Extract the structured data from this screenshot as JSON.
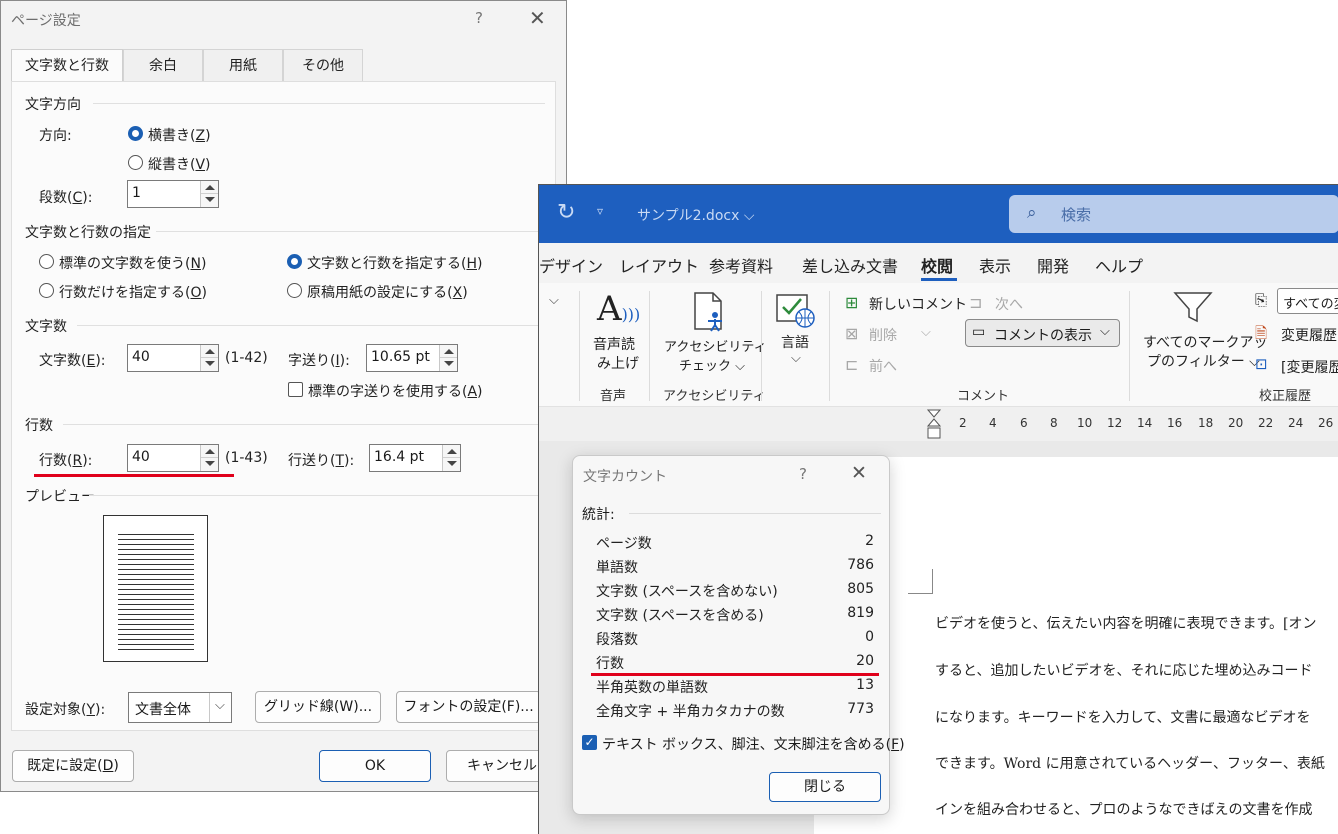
{
  "page_setup": {
    "title": "ページ設定",
    "help": "?",
    "close": "✕",
    "tabs": [
      "文字数と行数",
      "余白",
      "用紙",
      "その他"
    ],
    "direction": {
      "section": "文字方向",
      "label_pre": "方向:",
      "horizontal": {
        "text": "横書き(",
        "key": "Z",
        "end": ")"
      },
      "vertical": {
        "text": "縦書き(",
        "key": "V",
        "end": ")"
      },
      "columns_pre": "段数(",
      "columns_key": "C",
      "columns_end": "):",
      "columns_value": "1"
    },
    "grid": {
      "section": "文字数と行数の指定",
      "opt1": {
        "text": "標準の文字数を使う(",
        "key": "N",
        "end": ")"
      },
      "opt2": {
        "text": "文字数と行数を指定する(",
        "key": "H",
        "end": ")"
      },
      "opt3": {
        "text": "行数だけを指定する(",
        "key": "O",
        "end": ")"
      },
      "opt4": {
        "text": "原稿用紙の設定にする(",
        "key": "X",
        "end": ")"
      }
    },
    "chars": {
      "section": "文字数",
      "label_pre": "文字数(",
      "label_key": "E",
      "label_end": "):",
      "value": "40",
      "range": "(1-42)",
      "pitch_pre": "字送り(",
      "pitch_key": "I",
      "pitch_end": "):",
      "pitch_value": "10.65 pt",
      "std_pitch": {
        "text": "標準の字送りを使用する(",
        "key": "A",
        "end": ")"
      }
    },
    "lines": {
      "section": "行数",
      "label_pre": "行数(",
      "label_key": "R",
      "label_end": "):",
      "value": "40",
      "range": "(1-43)",
      "pitch_pre": "行送り(",
      "pitch_key": "T",
      "pitch_end": "):",
      "pitch_value": "16.4 pt"
    },
    "preview": "プレビュー",
    "apply_pre": "設定対象(",
    "apply_key": "Y",
    "apply_end": "):",
    "apply_value": "文書全体",
    "grid_button": "グリッド線(W)...",
    "font_button": "フォントの設定(F)...",
    "default_pre": "既定に設定(",
    "default_key": "D",
    "default_end": ")",
    "ok": "OK",
    "cancel": "キャンセル"
  },
  "word": {
    "doc_name": "サンプル2.docx ⌵",
    "search_placeholder": "検索",
    "menu": [
      "デザイン",
      "レイアウト",
      "参考資料",
      "差し込み文書",
      "校閲",
      "表示",
      "開発",
      "ヘルプ"
    ],
    "ribbon": {
      "read_aloud": [
        "音声読",
        "み上げ"
      ],
      "accessibility": [
        "アクセシビリティ",
        "チェック ⌵"
      ],
      "language": "言語",
      "new_comment": "新しいコメント",
      "delete": "削除",
      "prev": "前へ",
      "next": "次へ",
      "show_comments": "コメントの表示",
      "markup_filter": [
        "すべてのマークアッ",
        "プのフィルター ⌵"
      ],
      "all_changes": "すべての変",
      "change_history": "変更履歴",
      "change_history2": "[変更履歴",
      "group_voice": "音声",
      "group_access": "アクセシビリティ",
      "group_comment": "コメント",
      "group_track": "校正履歴"
    },
    "ruler": [
      "2",
      "4",
      "6",
      "8",
      "10",
      "12",
      "14",
      "16",
      "18",
      "20",
      "22",
      "24",
      "26"
    ],
    "body": [
      "ビデオを使うと、伝えたい内容を明確に表現できます。[オン",
      "すると、追加したいビデオを、それに応じた埋め込みコード",
      "になります。キーワードを入力して、文書に最適なビデオを",
      "できます。Word に用意されているヘッダー、フッター、表紙",
      "インを組み合わせると、プロのようなできばえの文書を作成"
    ]
  },
  "word_count": {
    "title": "文字カウント",
    "help": "?",
    "close": "✕",
    "stats_label": "統計:",
    "rows": [
      {
        "k": "ページ数",
        "v": "2"
      },
      {
        "k": "単語数",
        "v": "786"
      },
      {
        "k": "文字数 (スペースを含めない)",
        "v": "805"
      },
      {
        "k": "文字数 (スペースを含める)",
        "v": "819"
      },
      {
        "k": "段落数",
        "v": "0"
      },
      {
        "k": "行数",
        "v": "20"
      },
      {
        "k": "半角英数の単語数",
        "v": "13"
      },
      {
        "k": "全角文字 + 半角カタカナの数",
        "v": "773"
      }
    ],
    "include": {
      "text": "テキスト ボックス、脚注、文末脚注を含める(",
      "key": "F",
      "end": ")"
    },
    "close_button": "閉じる"
  }
}
